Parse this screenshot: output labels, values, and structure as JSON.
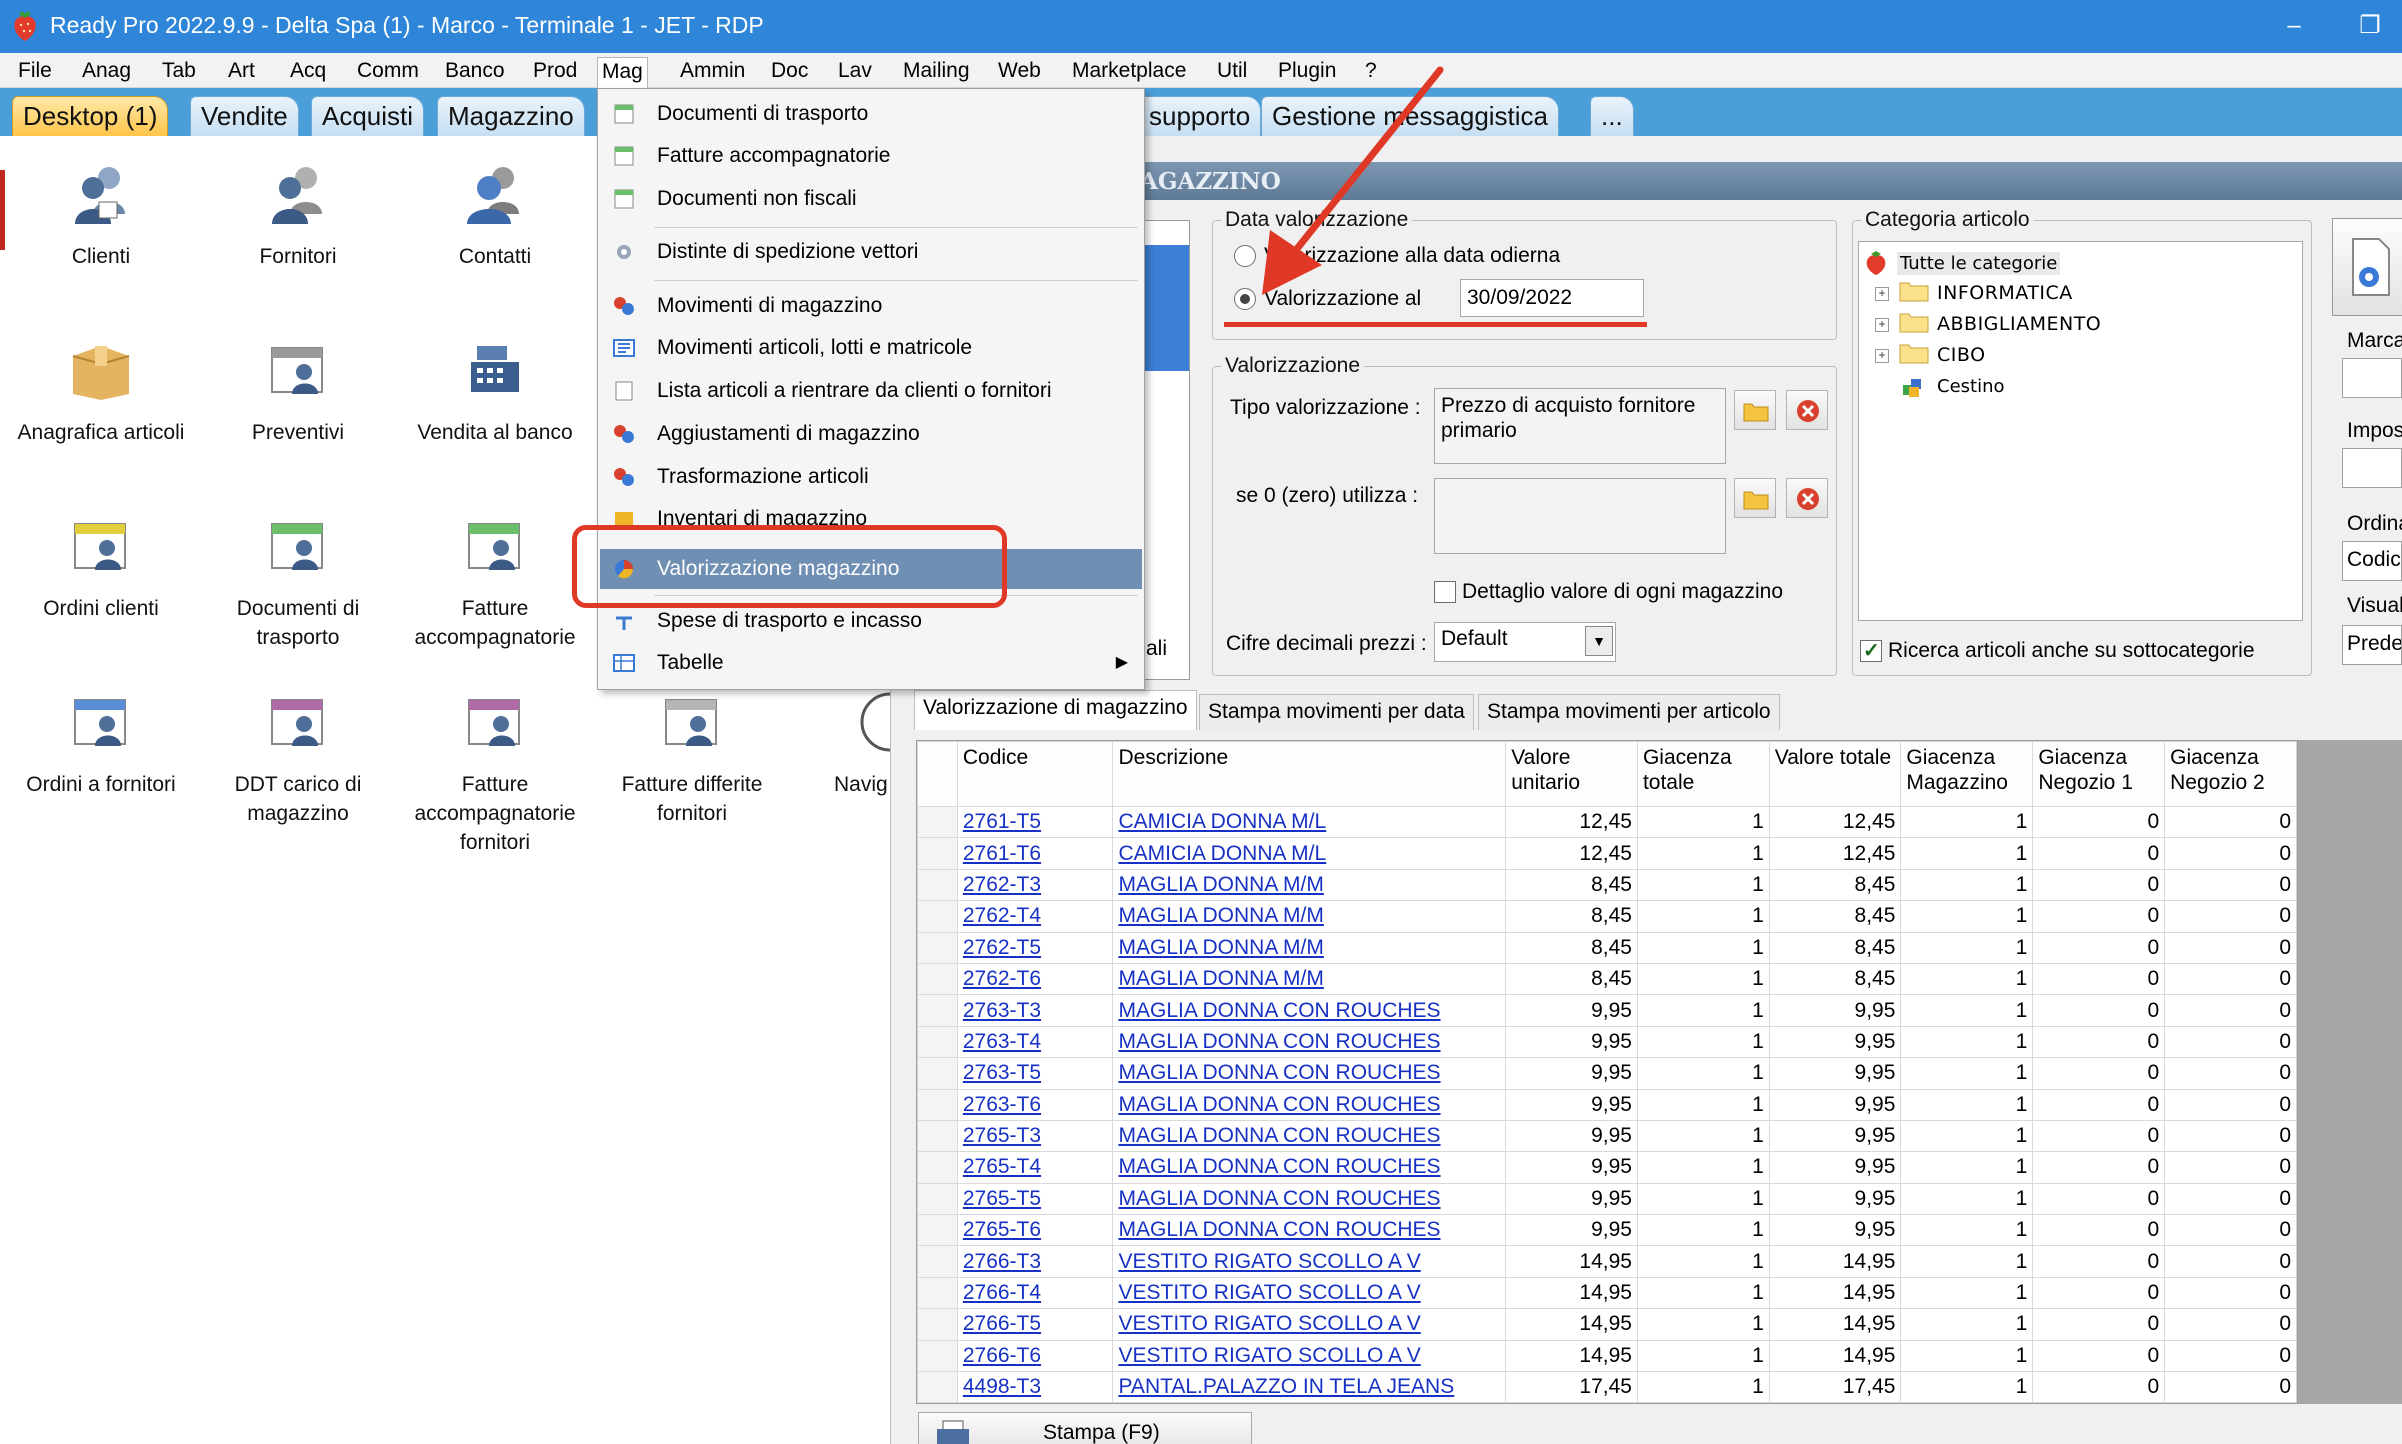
{
  "window": {
    "title": "Ready Pro 2022.9.9 - Delta Spa (1) - Marco - Terminale 1 - JET - RDP",
    "minimize_glyph": "‒",
    "restore_glyph": "❐"
  },
  "menubar": [
    "File",
    "Anag",
    "Tab",
    "Art",
    "Acq",
    "Comm",
    "Banco",
    "Prod",
    "Mag",
    "Ammin",
    "Doc",
    "Lav",
    "Mailing",
    "Web",
    "Marketplace",
    "Util",
    "Plugin",
    "?"
  ],
  "tabs": [
    "Desktop (1)",
    "Vendite",
    "Acquisti",
    "Magazzino",
    "supporto",
    "Gestione messaggistica",
    "..."
  ],
  "desktop": {
    "icons": [
      {
        "label": "Clienti",
        "icon": "users-icon"
      },
      {
        "label": "Fornitori",
        "icon": "supplier-icon"
      },
      {
        "label": "Contatti",
        "icon": "contacts-icon"
      },
      {
        "label": "Anagrafica articoli",
        "icon": "box-icon"
      },
      {
        "label": "Preventivi",
        "icon": "quote-icon"
      },
      {
        "label": "Vendita al banco",
        "icon": "cash-register-icon"
      },
      {
        "label": "Ordini clienti",
        "icon": "customer-orders-icon"
      },
      {
        "label": "Documenti di trasporto",
        "icon": "transport-docs-icon"
      },
      {
        "label": "Fatture accompagnatorie",
        "icon": "invoice-icon"
      },
      {
        "label": "Ordini a fornitori",
        "icon": "supplier-orders-icon"
      },
      {
        "label": "DDT carico di magazzino",
        "icon": "ddt-icon"
      },
      {
        "label": "Fatture accompagnatorie fornitori",
        "icon": "supplier-invoice-icon"
      },
      {
        "label": "Fatture differite fornitori",
        "icon": "deferred-invoice-icon"
      },
      {
        "label": "Navig",
        "icon": "navigator-icon"
      }
    ]
  },
  "mag_menu": {
    "items": [
      "Documenti di trasporto",
      "Fatture accompagnatorie",
      "Documenti non fiscali",
      "Distinte di spedizione vettori",
      "Movimenti di magazzino",
      "Movimenti articoli, lotti e matricole",
      "Lista articoli a rientrare da clienti o fornitori",
      "Aggiustamenti di magazzino",
      "Trasformazione articoli",
      "Inventari di magazzino",
      "Valorizzazione magazzino",
      "Spese di trasporto e incasso",
      "Tabelle"
    ]
  },
  "panel": {
    "header_title": "AGAZZINO",
    "left_list_label": "ali",
    "data_group": {
      "legend": "Data valorizzazione",
      "option_today": "Valorizzazione alla data odierna",
      "option_at": "Valorizzazione al",
      "date_value": "30/09/2022",
      "selected": "option_at"
    },
    "valorizzazione_group": {
      "legend": "Valorizzazione",
      "tipo_label": "Tipo valorizzazione :",
      "tipo_value": "Prezzo di acquisto fornitore primario",
      "zero_label": "se 0 (zero) utilizza :",
      "zero_value": "",
      "detail_checkbox": "Dettaglio valore di ogni magazzino",
      "decimals_label": "Cifre decimali prezzi :",
      "decimals_value": "Default"
    },
    "categoria_group": {
      "legend": "Categoria articolo",
      "tree": [
        "Tutte le categorie",
        "INFORMATICA",
        "ABBIGLIAMENTO",
        "CIBO",
        "Cestino"
      ],
      "subcat_checkbox": "Ricerca articoli anche su sottocategorie"
    },
    "far_right": {
      "marca_label": "Marca",
      "impos_label": "Impos",
      "ordina_label": "Ordina",
      "ordina_value": "Codic",
      "visual_label": "Visual",
      "visual_value": "Prede"
    },
    "subtabs": [
      "Valorizzazione di magazzino",
      "Stampa movimenti per data",
      "Stampa movimenti per articolo"
    ],
    "bottom_button": "Stampa (F9)"
  },
  "grid": {
    "columns": [
      "Codice",
      "Descrizione",
      "Valore unitario",
      "Giacenza totale",
      "Valore totale",
      "Giacenza Magazzino",
      "Giacenza Negozio 1",
      "Giacenza Negozio 2"
    ],
    "rows": [
      [
        "2761-T5",
        "CAMICIA DONNA M/L",
        "12,45",
        "1",
        "12,45",
        "1",
        "0",
        "0"
      ],
      [
        "2761-T6",
        "CAMICIA DONNA M/L",
        "12,45",
        "1",
        "12,45",
        "1",
        "0",
        "0"
      ],
      [
        "2762-T3",
        "MAGLIA DONNA M/M",
        "8,45",
        "1",
        "8,45",
        "1",
        "0",
        "0"
      ],
      [
        "2762-T4",
        "MAGLIA DONNA M/M",
        "8,45",
        "1",
        "8,45",
        "1",
        "0",
        "0"
      ],
      [
        "2762-T5",
        "MAGLIA DONNA M/M",
        "8,45",
        "1",
        "8,45",
        "1",
        "0",
        "0"
      ],
      [
        "2762-T6",
        "MAGLIA DONNA M/M",
        "8,45",
        "1",
        "8,45",
        "1",
        "0",
        "0"
      ],
      [
        "2763-T3",
        "MAGLIA DONNA CON ROUCHES",
        "9,95",
        "1",
        "9,95",
        "1",
        "0",
        "0"
      ],
      [
        "2763-T4",
        "MAGLIA DONNA CON ROUCHES",
        "9,95",
        "1",
        "9,95",
        "1",
        "0",
        "0"
      ],
      [
        "2763-T5",
        "MAGLIA DONNA CON ROUCHES",
        "9,95",
        "1",
        "9,95",
        "1",
        "0",
        "0"
      ],
      [
        "2763-T6",
        "MAGLIA DONNA CON ROUCHES",
        "9,95",
        "1",
        "9,95",
        "1",
        "0",
        "0"
      ],
      [
        "2765-T3",
        "MAGLIA DONNA CON ROUCHES",
        "9,95",
        "1",
        "9,95",
        "1",
        "0",
        "0"
      ],
      [
        "2765-T4",
        "MAGLIA DONNA CON ROUCHES",
        "9,95",
        "1",
        "9,95",
        "1",
        "0",
        "0"
      ],
      [
        "2765-T5",
        "MAGLIA DONNA CON ROUCHES",
        "9,95",
        "1",
        "9,95",
        "1",
        "0",
        "0"
      ],
      [
        "2765-T6",
        "MAGLIA DONNA CON ROUCHES",
        "9,95",
        "1",
        "9,95",
        "1",
        "0",
        "0"
      ],
      [
        "2766-T3",
        "VESTITO RIGATO SCOLLO A V",
        "14,95",
        "1",
        "14,95",
        "1",
        "0",
        "0"
      ],
      [
        "2766-T4",
        "VESTITO RIGATO SCOLLO A V",
        "14,95",
        "1",
        "14,95",
        "1",
        "0",
        "0"
      ],
      [
        "2766-T5",
        "VESTITO RIGATO SCOLLO A V",
        "14,95",
        "1",
        "14,95",
        "1",
        "0",
        "0"
      ],
      [
        "2766-T6",
        "VESTITO RIGATO SCOLLO A V",
        "14,95",
        "1",
        "14,95",
        "1",
        "0",
        "0"
      ],
      [
        "4498-T3",
        "PANTAL.PALAZZO IN TELA JEANS",
        "17,45",
        "1",
        "17,45",
        "1",
        "0",
        "0"
      ]
    ]
  },
  "colors": {
    "titlebar": "#2f86d9",
    "tabbar": "#4a9fd9",
    "active_tab": "#ffc54a",
    "menu_highlight": "#6f8fb3",
    "annotation": "#e03826",
    "link": "#1631c4"
  }
}
